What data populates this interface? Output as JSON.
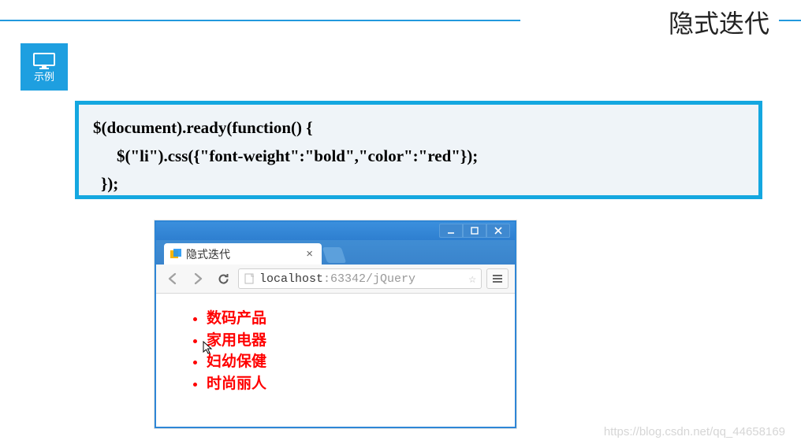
{
  "header": {
    "section_title": "隐式迭代",
    "example_label": "示例"
  },
  "code": {
    "line1": "$(document).ready(function() {",
    "line2": "$(\"li\").css({\"font-weight\":\"bold\",\"color\":\"red\"});",
    "line3": "});"
  },
  "browser": {
    "tab_title": "隐式迭代",
    "url_host": "localhost",
    "url_port": ":63342",
    "url_path": "/jQuery",
    "list_items": [
      "数码产品",
      "家用电器",
      "妇幼保健",
      "时尚丽人"
    ]
  },
  "watermark": "https://blog.csdn.net/qq_44658169"
}
